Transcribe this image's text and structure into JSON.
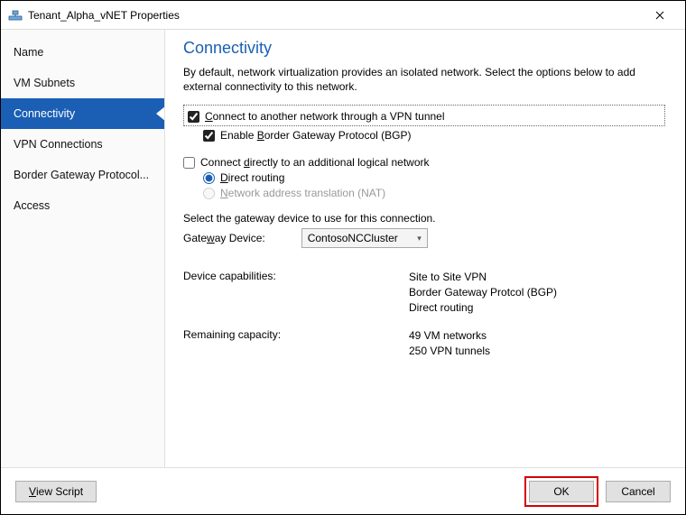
{
  "window": {
    "title": "Tenant_Alpha_vNET Properties"
  },
  "sidebar": {
    "items": [
      {
        "label": "Name"
      },
      {
        "label": "VM Subnets"
      },
      {
        "label": "Connectivity"
      },
      {
        "label": "VPN Connections"
      },
      {
        "label": "Border Gateway Protocol..."
      },
      {
        "label": "Access"
      }
    ]
  },
  "content": {
    "heading": "Connectivity",
    "intro": "By default, network virtualization provides an isolated network. Select the options below to add external connectivity to this network.",
    "vpn_tunnel": {
      "prefix": "C",
      "rest": "onnect to another network through a VPN tunnel"
    },
    "bgp": {
      "prefix": "Enable ",
      "u": "B",
      "rest": "order Gateway Protocol (BGP)"
    },
    "direct_logical": {
      "prefix": "Connect ",
      "u": "d",
      "rest": "irectly to an additional logical network"
    },
    "direct_routing": {
      "u": "D",
      "rest": "irect routing"
    },
    "nat": {
      "u": "N",
      "rest": "etwork address translation (NAT)"
    },
    "gateway_helper": "Select the gateway device to use for this connection.",
    "gateway_label_pre": "Gate",
    "gateway_label_u": "w",
    "gateway_label_post": "ay Device:",
    "gateway_selected": "ContosoNCCluster",
    "cap_label": "Device capabilities:",
    "cap_vals": [
      "Site to Site VPN",
      "Border Gateway Protcol (BGP)",
      "Direct routing"
    ],
    "remain_label": "Remaining capacity:",
    "remain_vals": [
      "49 VM networks",
      "250 VPN tunnels"
    ]
  },
  "footer": {
    "view_script_pre": "",
    "view_script_u": "V",
    "view_script_post": "iew Script",
    "ok": "OK",
    "cancel": "Cancel"
  }
}
